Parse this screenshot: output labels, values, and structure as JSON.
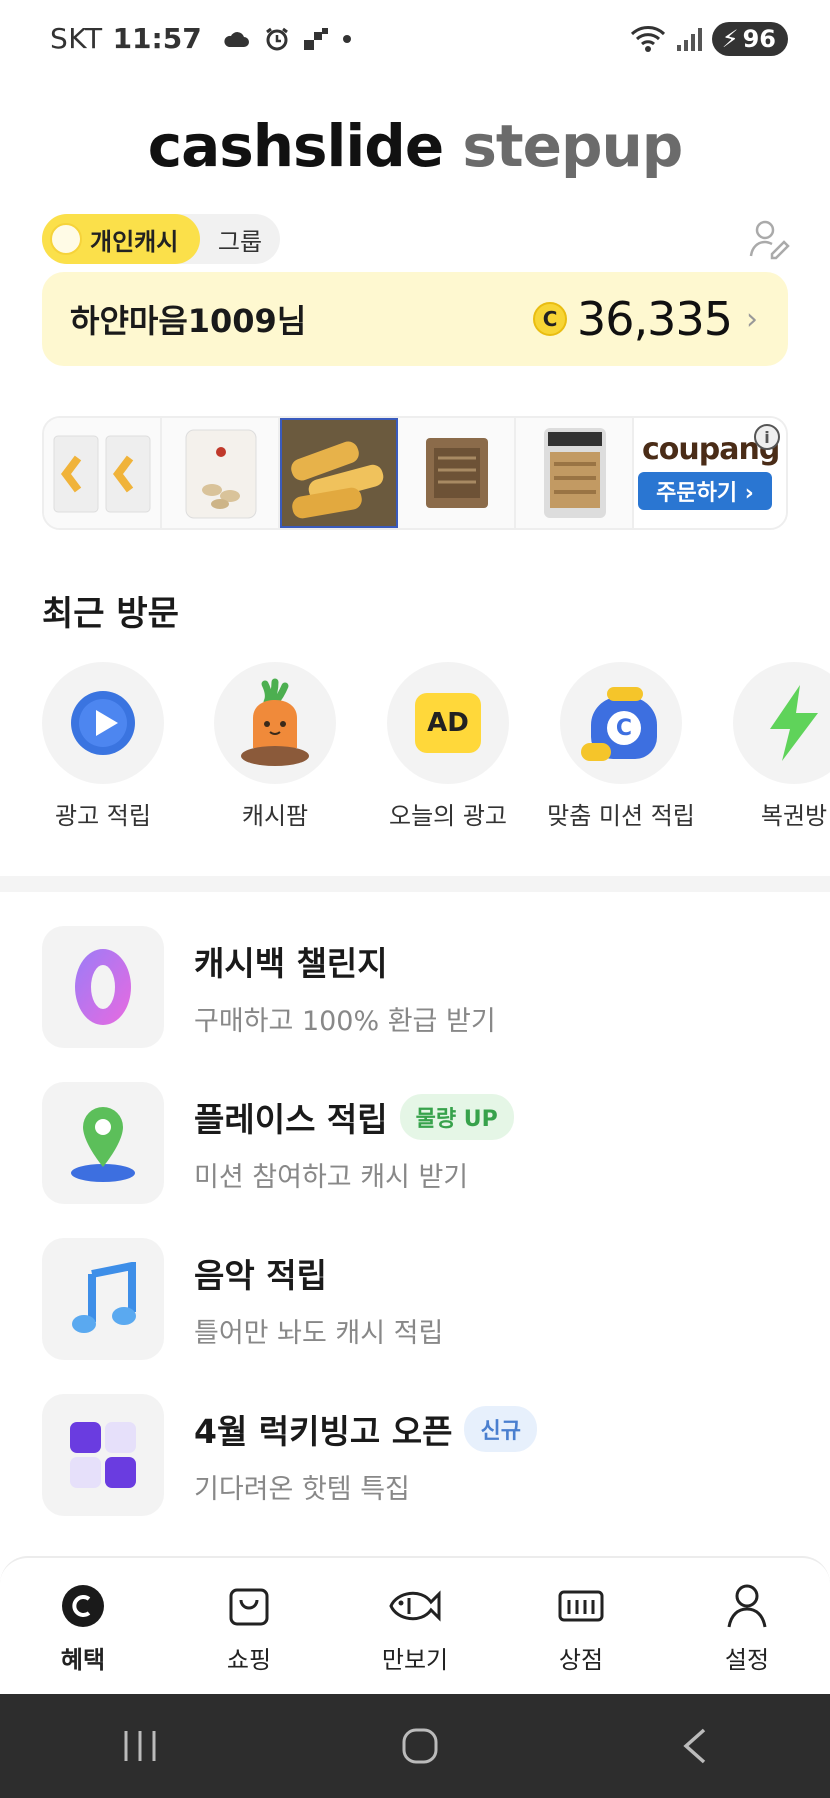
{
  "status_bar": {
    "carrier": "SKT",
    "time": "11:57",
    "battery": "96",
    "icons": [
      "cloud-icon",
      "alarm-icon",
      "data-icon",
      "dot-icon",
      "wifi-icon",
      "signal-icon",
      "battery-icon"
    ]
  },
  "logo": {
    "part1": "cashslide",
    "part2": "stepup"
  },
  "toggle": {
    "personal": "개인캐시",
    "group": "그룹"
  },
  "cash": {
    "user": "하얀마음1009님",
    "coin_symbol": "C",
    "amount": "36,335",
    "chevron": "›"
  },
  "ad": {
    "brand": "coupang",
    "cta": "주문하기 ›",
    "info": "i"
  },
  "recent": {
    "title": "최근 방문",
    "items": [
      {
        "label": "광고 적립",
        "icon": "play-icon"
      },
      {
        "label": "캐시팜",
        "icon": "carrot-icon"
      },
      {
        "label": "오늘의 광고",
        "icon": "ad-icon",
        "icon_text": "AD"
      },
      {
        "label": "맞춤 미션 적립",
        "icon": "coin-bag-icon",
        "icon_text": "C"
      },
      {
        "label": "복권방",
        "icon": "lightning-icon"
      }
    ]
  },
  "menu": [
    {
      "title": "캐시백 챌린지",
      "sub": "구매하고 100% 환급 받기",
      "icon": "zero-icon",
      "badge": ""
    },
    {
      "title": "플레이스 적립",
      "sub": "미션 참여하고 캐시 받기",
      "icon": "location-pin-icon",
      "badge": "물량 UP"
    },
    {
      "title": "음악 적립",
      "sub": "틀어만 놔도 캐시 적립",
      "icon": "music-note-icon",
      "badge": ""
    },
    {
      "title": "4월 럭키빙고 오픈",
      "sub": "기다려온 핫템 특집",
      "icon": "bingo-grid-icon",
      "badge": "신규"
    }
  ],
  "bottom_nav": [
    {
      "label": "혜택",
      "icon": "benefit-coin-icon",
      "active": true
    },
    {
      "label": "쇼핑",
      "icon": "shopping-bag-icon",
      "active": false
    },
    {
      "label": "만보기",
      "icon": "pedometer-fish-icon",
      "active": false
    },
    {
      "label": "상점",
      "icon": "store-icon",
      "active": false
    },
    {
      "label": "설정",
      "icon": "person-icon",
      "active": false
    }
  ],
  "colors": {
    "accent_yellow": "#fbe04a",
    "card_bg": "#fef8d0",
    "badge_green": "#37a24b",
    "badge_blue": "#4a7fcf"
  }
}
